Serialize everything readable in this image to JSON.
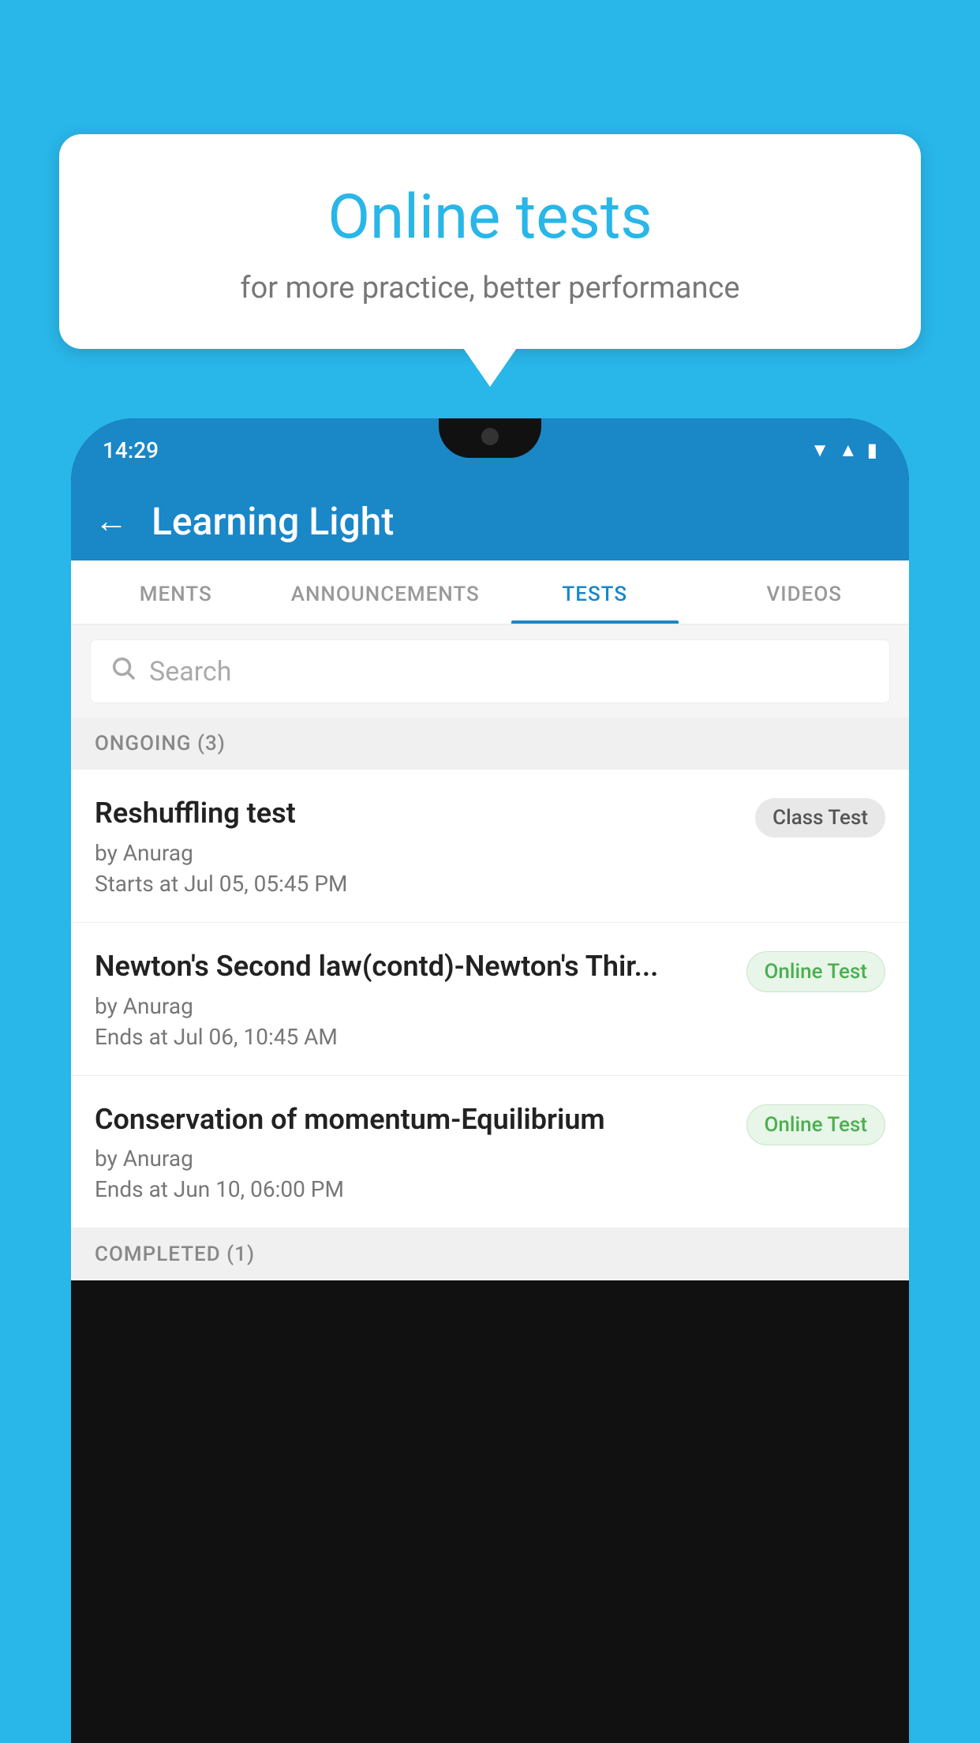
{
  "background_color": "#29b6e8",
  "bubble": {
    "title": "Online tests",
    "subtitle": "for more practice, better performance"
  },
  "phone": {
    "status_time": "14:29",
    "status_icons": [
      "wifi",
      "signal",
      "battery"
    ]
  },
  "app": {
    "title": "Learning Light",
    "back_label": "←"
  },
  "tabs": [
    {
      "label": "MENTS",
      "active": false
    },
    {
      "label": "ANNOUNCEMENTS",
      "active": false
    },
    {
      "label": "TESTS",
      "active": true
    },
    {
      "label": "VIDEOS",
      "active": false
    }
  ],
  "search": {
    "placeholder": "Search"
  },
  "sections": [
    {
      "header": "ONGOING (3)",
      "tests": [
        {
          "name": "Reshuffling test",
          "by": "by Anurag",
          "time": "Starts at  Jul 05, 05:45 PM",
          "badge": "Class Test",
          "badge_type": "class"
        },
        {
          "name": "Newton's Second law(contd)-Newton's Thir...",
          "by": "by Anurag",
          "time": "Ends at  Jul 06, 10:45 AM",
          "badge": "Online Test",
          "badge_type": "online"
        },
        {
          "name": "Conservation of momentum-Equilibrium",
          "by": "by Anurag",
          "time": "Ends at  Jun 10, 06:00 PM",
          "badge": "Online Test",
          "badge_type": "online"
        }
      ]
    }
  ],
  "completed_section": "COMPLETED (1)"
}
